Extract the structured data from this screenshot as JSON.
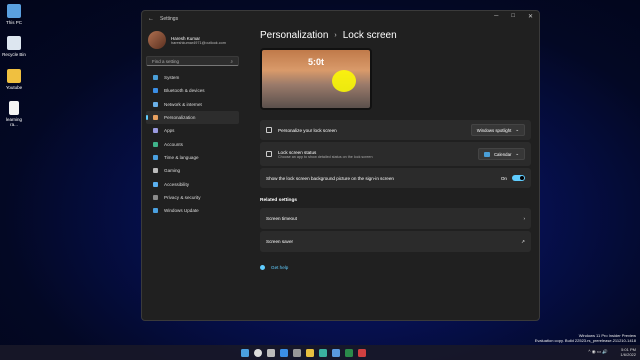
{
  "desktop": {
    "icons": [
      {
        "label": "This PC",
        "icon": "computer-icon"
      },
      {
        "label": "Recycle Bin",
        "icon": "recycle-bin-icon"
      },
      {
        "label": "Youtube",
        "icon": "folder-icon"
      },
      {
        "label": "learning ra...",
        "icon": "file-icon"
      }
    ]
  },
  "window": {
    "title": "Settings",
    "back_icon": "back-arrow-icon",
    "controls": {
      "minimize": "─",
      "maximize": "□",
      "close": "✕"
    }
  },
  "profile": {
    "name": "Haresh Kumar",
    "email": "hareshkumar4971@outlook.com"
  },
  "search": {
    "placeholder": "Find a setting",
    "icon": "⌕"
  },
  "nav": [
    {
      "label": "System",
      "icon": "system-icon",
      "color": "#4a9fd8",
      "active": false
    },
    {
      "label": "Bluetooth & devices",
      "icon": "bluetooth-icon",
      "color": "#3a8ee6",
      "active": false
    },
    {
      "label": "Network & internet",
      "icon": "network-icon",
      "color": "#6ab0e8",
      "active": false
    },
    {
      "label": "Personalization",
      "icon": "brush-icon",
      "color": "#e8a060",
      "active": true
    },
    {
      "label": "Apps",
      "icon": "apps-icon",
      "color": "#9a9ae0",
      "active": false
    },
    {
      "label": "Accounts",
      "icon": "accounts-icon",
      "color": "#3fb38a",
      "active": false
    },
    {
      "label": "Time & language",
      "icon": "globe-icon",
      "color": "#4aa0e0",
      "active": false
    },
    {
      "label": "Gaming",
      "icon": "gaming-icon",
      "color": "#bbbbbb",
      "active": false
    },
    {
      "label": "Accessibility",
      "icon": "accessibility-icon",
      "color": "#5ab0f0",
      "active": false
    },
    {
      "label": "Privacy & security",
      "icon": "shield-icon",
      "color": "#8a8a8a",
      "active": false
    },
    {
      "label": "Windows Update",
      "icon": "update-icon",
      "color": "#4aa0e0",
      "active": false
    }
  ],
  "main": {
    "breadcrumb_parent": "Personalization",
    "breadcrumb_sep": "›",
    "breadcrumb_current": "Lock screen",
    "preview_time": "5:0t",
    "personalize": {
      "label": "Personalize your lock screen",
      "value": "Windows spotlight",
      "chevron": "⌄"
    },
    "status": {
      "label": "Lock screen status",
      "sub": "Choose an app to show detailed status on the lock screen",
      "value": "Calendar",
      "chevron": "⌄"
    },
    "background": {
      "label": "Show the lock screen background picture on the sign-in screen",
      "toggle_text": "On",
      "toggle_on": true
    },
    "related_title": "Related settings",
    "related": [
      {
        "label": "Screen timeout",
        "icon": "›"
      },
      {
        "label": "Screen saver",
        "icon": "↗"
      }
    ],
    "help": "Get help"
  },
  "watermark": {
    "line1": "Windows 11 Pro Insider Preview",
    "line2": "Evaluation copy. Build 22523.rs_prerelease.211210-1418"
  },
  "taskbar": {
    "icons": [
      {
        "name": "start-icon",
        "color": "#4aa0e0"
      },
      {
        "name": "search-icon",
        "color": "#dddddd"
      },
      {
        "name": "task-view-icon",
        "color": "#bbbbbb"
      },
      {
        "name": "widgets-icon",
        "color": "#3a8ee6"
      },
      {
        "name": "settings-icon",
        "color": "#999999"
      },
      {
        "name": "file-explorer-icon",
        "color": "#e8c040"
      },
      {
        "name": "edge-icon",
        "color": "#3ab0a0"
      },
      {
        "name": "store-icon",
        "color": "#5a9ae0"
      },
      {
        "name": "excel-icon",
        "color": "#2a8a4a"
      },
      {
        "name": "app-icon",
        "color": "#d04040"
      }
    ],
    "time": "5:01 PM",
    "date": "1/6/2022",
    "tray": "^ ◉ ▭ 🔊"
  }
}
